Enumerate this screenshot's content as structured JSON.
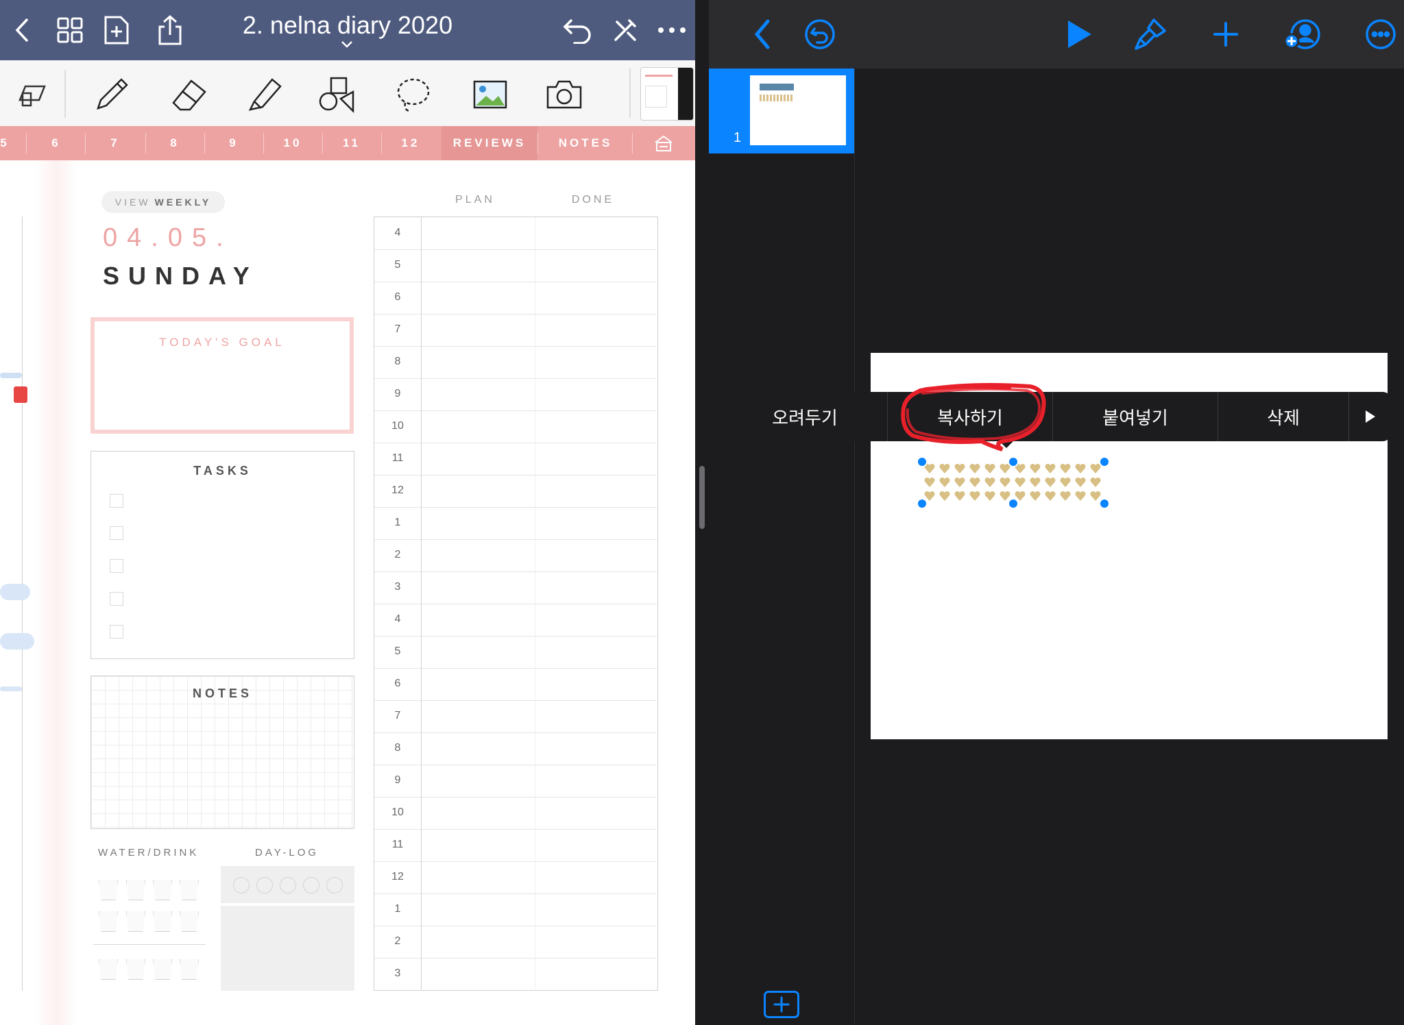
{
  "left_app": {
    "doc_title": "2. nelna diary 2020",
    "tabs": [
      "5",
      "6",
      "7",
      "8",
      "9",
      "10",
      "11",
      "12",
      "REVIEWS",
      "NOTES"
    ],
    "view_pill": {
      "prefix": "VIEW",
      "bold": "WEEKLY"
    },
    "date": "04.05.",
    "day": "SUNDAY",
    "goal_title": "TODAY'S GOAL",
    "tasks_title": "TASKS",
    "notes_title": "NOTES",
    "water_title": "WATER/DRINK",
    "daylog_title": "DAY-LOG",
    "plan_label": "PLAN",
    "done_label": "DONE",
    "hours": [
      "4",
      "5",
      "6",
      "7",
      "8",
      "9",
      "10",
      "11",
      "12",
      "1",
      "2",
      "3",
      "4",
      "5",
      "6",
      "7",
      "8",
      "9",
      "10",
      "11",
      "12",
      "1",
      "2",
      "3"
    ]
  },
  "right_app": {
    "slide_number": "1",
    "context_menu": [
      "오려두기",
      "복사하기",
      "붙여넣기",
      "삭제"
    ],
    "highlighted_item": "복사하기",
    "accent": "#0a84ff",
    "highlight_color": "#e8202a"
  }
}
